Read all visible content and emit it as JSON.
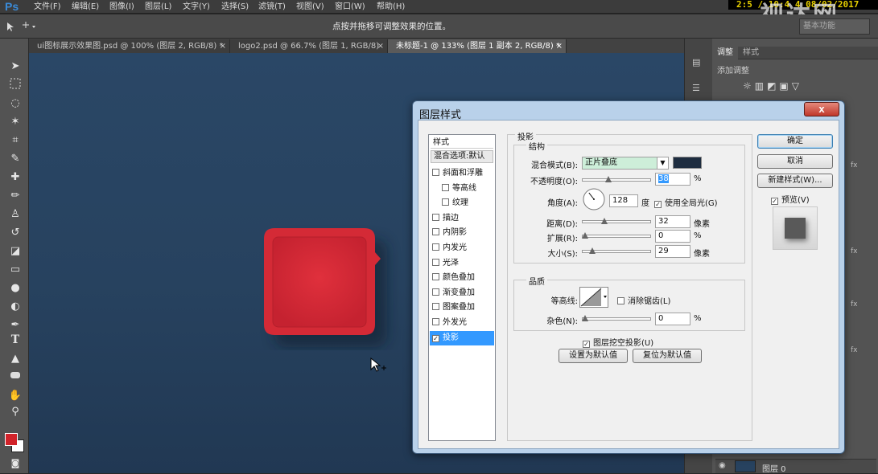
{
  "app": {
    "logo": "Ps"
  },
  "menu": [
    "文件(F)",
    "编辑(E)",
    "图像(I)",
    "图层(L)",
    "文字(Y)",
    "选择(S)",
    "滤镜(T)",
    "视图(V)",
    "窗口(W)",
    "帮助(H)"
  ],
  "clock": "2:5 / 10:4 4 08/02/2017",
  "watermark": "视达网",
  "options": {
    "hint": "点按并拖移可调整效果的位置。",
    "workspace": "基本功能"
  },
  "tabs": [
    "ui图标展示效果图.psd @ 100% (图层 2, RGB/8) *",
    "logo2.psd @ 66.7% (图层 1, RGB/8)",
    "未标题-1 @ 133% (图层 1 副本 2, RGB/8) *"
  ],
  "right_panel": {
    "tab_adjust": "调整",
    "tab_style": "样式",
    "add_adjust": "添加调整",
    "layer_name": "图层 0",
    "fx": "fx"
  },
  "colors": {
    "foreground": "#d2232a",
    "background": "#ffffff",
    "shadow_color": "#1e2d40",
    "canvas": "#27425f",
    "icon_red": "#d42a36"
  },
  "dialog": {
    "title": "图层样式",
    "close": "x",
    "styles_header": "样式",
    "blend_options": "混合选项:默认",
    "style_items": [
      {
        "label": "斜面和浮雕",
        "checked": false,
        "indent": false
      },
      {
        "label": "等高线",
        "checked": false,
        "indent": true
      },
      {
        "label": "纹理",
        "checked": false,
        "indent": true
      },
      {
        "label": "描边",
        "checked": false,
        "indent": false
      },
      {
        "label": "内阴影",
        "checked": false,
        "indent": false
      },
      {
        "label": "内发光",
        "checked": false,
        "indent": false
      },
      {
        "label": "光泽",
        "checked": false,
        "indent": false
      },
      {
        "label": "颜色叠加",
        "checked": false,
        "indent": false
      },
      {
        "label": "渐变叠加",
        "checked": false,
        "indent": false
      },
      {
        "label": "图案叠加",
        "checked": false,
        "indent": false
      },
      {
        "label": "外发光",
        "checked": false,
        "indent": false
      },
      {
        "label": "投影",
        "checked": true,
        "indent": false,
        "selected": true
      }
    ],
    "section_title": "投影",
    "structure": "结构",
    "blend_mode_label": "混合模式(B):",
    "blend_mode_value": "正片叠底",
    "opacity_label": "不透明度(O):",
    "opacity_value": "38",
    "opacity_unit": "%",
    "opacity_pct": 38,
    "angle_label": "角度(A):",
    "angle_value": "128",
    "angle_unit": "度",
    "global_light": "使用全局光(G)",
    "global_light_checked": true,
    "distance_label": "距离(D):",
    "distance_value": "32",
    "distance_unit": "像素",
    "distance_pct": 32,
    "spread_label": "扩展(R):",
    "spread_value": "0",
    "spread_unit": "%",
    "spread_pct": 0,
    "size_label": "大小(S):",
    "size_value": "29",
    "size_unit": "像素",
    "size_pct": 12,
    "quality": "品质",
    "contour_label": "等高线:",
    "antialias": "消除锯齿(L)",
    "noise_label": "杂色(N):",
    "noise_value": "0",
    "noise_unit": "%",
    "noise_pct": 0,
    "knockout": "图层挖空投影(U)",
    "knockout_checked": true,
    "make_default": "设置为默认值",
    "reset_default": "复位为默认值",
    "ok": "确定",
    "cancel": "取消",
    "new_style": "新建样式(W)...",
    "preview": "预览(V)",
    "preview_checked": true
  }
}
